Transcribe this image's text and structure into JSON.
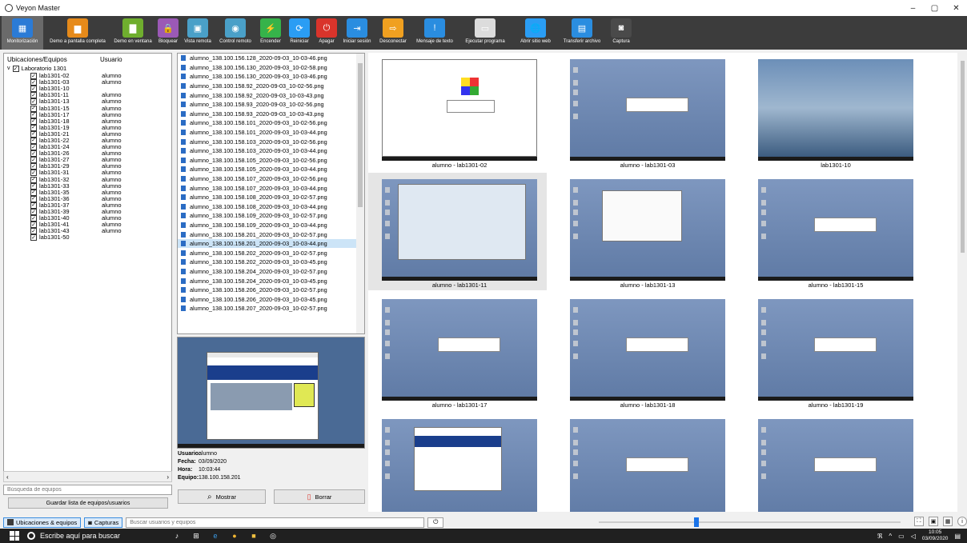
{
  "window": {
    "title": "Veyon Master",
    "controls": [
      "–",
      "▢",
      "✕"
    ]
  },
  "toolbar": [
    {
      "label": "Monitorización",
      "color": "#2b7bd6",
      "glyph": "▦",
      "icon": "monitoring-icon"
    },
    {
      "label": "Demo a pantalla completa",
      "color": "#e68a1a",
      "glyph": "▆",
      "icon": "fullscreen-demo-icon"
    },
    {
      "label": "Demo en ventana",
      "color": "#6fae2e",
      "glyph": "▇",
      "icon": "window-demo-icon"
    },
    {
      "label": "Bloquear",
      "color": "#9b59b6",
      "glyph": "🔒",
      "icon": "lock-icon"
    },
    {
      "label": "Vista remota",
      "color": "#4aa0c8",
      "glyph": "▣",
      "icon": "remote-view-icon"
    },
    {
      "label": "Control remoto",
      "color": "#4aa0c8",
      "glyph": "◉",
      "icon": "remote-control-icon"
    },
    {
      "label": "Encender",
      "color": "#36b34a",
      "glyph": "⚡",
      "icon": "power-on-icon"
    },
    {
      "label": "Reiniciar",
      "color": "#2a9df4",
      "glyph": "⟳",
      "icon": "reboot-icon"
    },
    {
      "label": "Apagar",
      "color": "#d9342b",
      "glyph": "⏻",
      "icon": "power-off-icon"
    },
    {
      "label": "Iniciar sesión",
      "color": "#2a8de0",
      "glyph": "⇥",
      "icon": "login-icon"
    },
    {
      "label": "Desconectar",
      "color": "#f0a020",
      "glyph": "⇨",
      "icon": "logout-icon"
    },
    {
      "label": "Mensaje de texto",
      "color": "#2a8de0",
      "glyph": "!",
      "icon": "message-icon"
    },
    {
      "label": "Ejecutar programa",
      "color": "#dcdcdc",
      "glyph": "▭",
      "icon": "run-program-icon"
    },
    {
      "label": "Abrir sitio web",
      "color": "#2a9df4",
      "glyph": "🌐",
      "icon": "website-icon"
    },
    {
      "label": "Transferir archivo",
      "color": "#2a8de0",
      "glyph": "▤",
      "icon": "file-transfer-icon"
    },
    {
      "label": "Captura",
      "color": "#4a4a4a",
      "glyph": "◙",
      "icon": "screenshot-icon"
    }
  ],
  "tree": {
    "col_name": "Ubicaciones/Equipos",
    "col_user": "Usuario",
    "root": "Laboratorio 1301",
    "items": [
      {
        "name": "lab1301-02",
        "user": "alumno"
      },
      {
        "name": "lab1301-03",
        "user": "alumno"
      },
      {
        "name": "lab1301-10",
        "user": ""
      },
      {
        "name": "lab1301-11",
        "user": "alumno"
      },
      {
        "name": "lab1301-13",
        "user": "alumno"
      },
      {
        "name": "lab1301-15",
        "user": "alumno"
      },
      {
        "name": "lab1301-17",
        "user": "alumno"
      },
      {
        "name": "lab1301-18",
        "user": "alumno"
      },
      {
        "name": "lab1301-19",
        "user": "alumno"
      },
      {
        "name": "lab1301-21",
        "user": "alumno"
      },
      {
        "name": "lab1301-22",
        "user": "alumno"
      },
      {
        "name": "lab1301-24",
        "user": "alumno"
      },
      {
        "name": "lab1301-26",
        "user": "alumno"
      },
      {
        "name": "lab1301-27",
        "user": "alumno"
      },
      {
        "name": "lab1301-29",
        "user": "alumno"
      },
      {
        "name": "lab1301-31",
        "user": "alumno"
      },
      {
        "name": "lab1301-32",
        "user": "alumno"
      },
      {
        "name": "lab1301-33",
        "user": "alumno"
      },
      {
        "name": "lab1301-35",
        "user": "alumno"
      },
      {
        "name": "lab1301-36",
        "user": "alumno"
      },
      {
        "name": "lab1301-37",
        "user": "alumno"
      },
      {
        "name": "lab1301-39",
        "user": "alumno"
      },
      {
        "name": "lab1301-40",
        "user": "alumno"
      },
      {
        "name": "lab1301-41",
        "user": "alumno"
      },
      {
        "name": "lab1301-43",
        "user": "alumno"
      },
      {
        "name": "lab1301-50",
        "user": ""
      }
    ]
  },
  "left_search_placeholder": "Búsqueda de equipos",
  "save_button": "Guardar lista de equipos/usuarios",
  "files": [
    "alumno_138.100.156.128_2020-09-03_10-03-46.png",
    "alumno_138.100.156.130_2020-09-03_10-02-58.png",
    "alumno_138.100.156.130_2020-09-03_10-03-46.png",
    "alumno_138.100.158.92_2020-09-03_10-02-56.png",
    "alumno_138.100.158.92_2020-09-03_10-03-43.png",
    "alumno_138.100.158.93_2020-09-03_10-02-56.png",
    "alumno_138.100.158.93_2020-09-03_10-03-43.png",
    "alumno_138.100.158.101_2020-09-03_10-02-56.png",
    "alumno_138.100.158.101_2020-09-03_10-03-44.png",
    "alumno_138.100.158.103_2020-09-03_10-02-56.png",
    "alumno_138.100.158.103_2020-09-03_10-03-44.png",
    "alumno_138.100.158.105_2020-09-03_10-02-56.png",
    "alumno_138.100.158.105_2020-09-03_10-03-44.png",
    "alumno_138.100.158.107_2020-09-03_10-02-56.png",
    "alumno_138.100.158.107_2020-09-03_10-03-44.png",
    "alumno_138.100.158.108_2020-09-03_10-02-57.png",
    "alumno_138.100.158.108_2020-09-03_10-03-44.png",
    "alumno_138.100.158.109_2020-09-03_10-02-57.png",
    "alumno_138.100.158.109_2020-09-03_10-03-44.png",
    "alumno_138.100.158.201_2020-09-03_10-02-57.png",
    "alumno_138.100.158.201_2020-09-03_10-03-44.png",
    "alumno_138.100.158.202_2020-09-03_10-02-57.png",
    "alumno_138.100.158.202_2020-09-03_10-03-45.png",
    "alumno_138.100.158.204_2020-09-03_10-02-57.png",
    "alumno_138.100.158.204_2020-09-03_10-03-45.png",
    "alumno_138.100.158.206_2020-09-03_10-02-57.png",
    "alumno_138.100.158.206_2020-09-03_10-03-45.png",
    "alumno_138.100.158.207_2020-09-03_10-02-57.png"
  ],
  "selected_file_index": 20,
  "info": {
    "user_label": "Usuario:",
    "user": "alumno",
    "date_label": "Fecha:",
    "date": "03/09/2020",
    "time_label": "Hora:",
    "time": "10:03:44",
    "host_label": "Equipo:",
    "host": "138.100.158.201"
  },
  "show_button": "Mostrar",
  "delete_button": "Borrar",
  "tiles": [
    "alumno - lab1301-02",
    "alumno - lab1301-03",
    "lab1301-10",
    "alumno - lab1301-11",
    "alumno - lab1301-13",
    "alumno - lab1301-15",
    "alumno - lab1301-17",
    "alumno - lab1301-18",
    "alumno - lab1301-19",
    "",
    "",
    ""
  ],
  "selected_tile_index": 3,
  "status": {
    "tab_locations": "Ubicaciones & equipos",
    "tab_captures": "Capturas",
    "search_placeholder": "Buscar usuarios y equipos",
    "zoom_slider_level": 0.32
  },
  "taskbar": {
    "search_text": "Escribe aquí para buscar",
    "time": "10:05",
    "date": "03/09/2020"
  }
}
